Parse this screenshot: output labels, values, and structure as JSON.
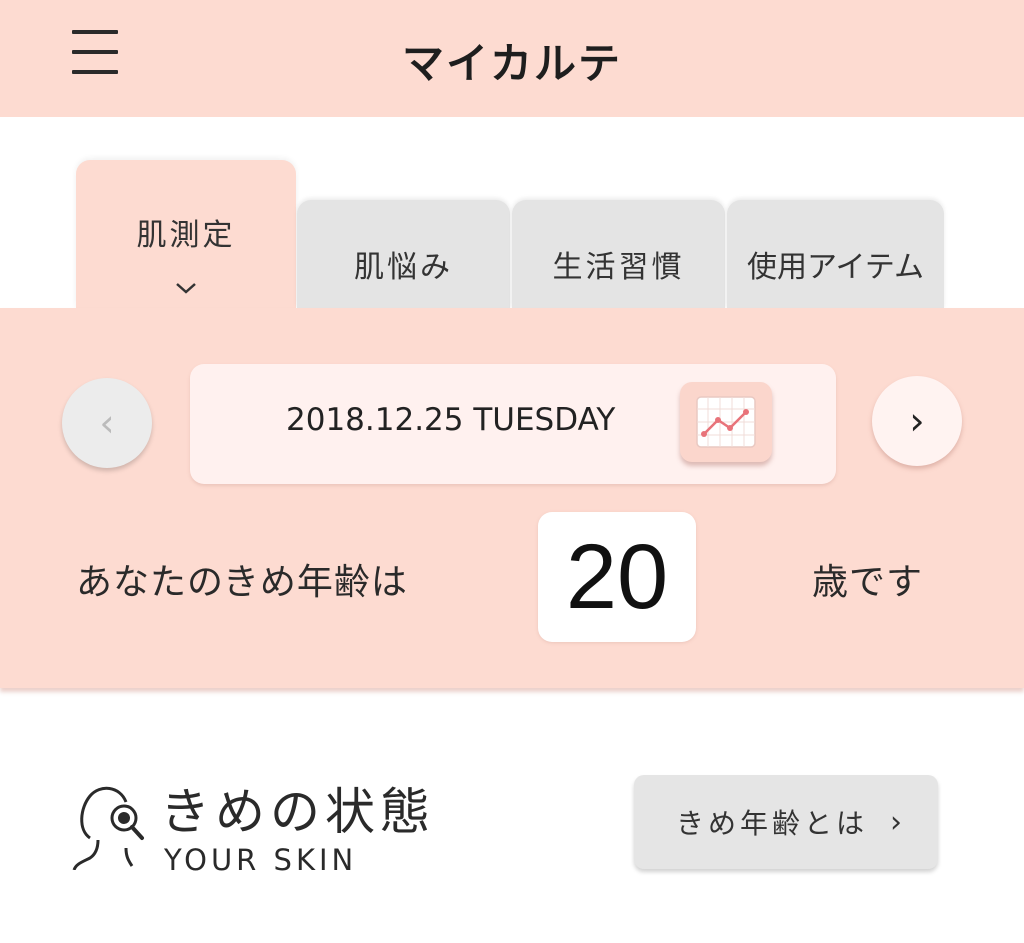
{
  "header": {
    "title": "マイカルテ",
    "menu_icon": "hamburger-menu-icon"
  },
  "tabs": [
    {
      "label": "肌測定",
      "active": true
    },
    {
      "label": "肌悩み",
      "active": false
    },
    {
      "label": "生活習慣",
      "active": false
    },
    {
      "label": "使用アイテム",
      "active": false
    }
  ],
  "date_nav": {
    "date": "2018.12.25 TUESDAY",
    "prev_glyph": "‹",
    "next_glyph": "›",
    "graph_icon": "line-graph-icon"
  },
  "age": {
    "prefix": "あなたのきめ年齢は",
    "value": "20",
    "suffix": "歳です"
  },
  "section": {
    "title": "きめの状態",
    "subtitle": "YOUR SKIN",
    "icon": "face-magnifier-icon",
    "about_button": "きめ年齢とは",
    "about_chevron": "›"
  },
  "colors": {
    "accent_bg": "#fddbd1",
    "tab_inactive": "#e4e4e4",
    "graph_line": "#e8737a"
  }
}
